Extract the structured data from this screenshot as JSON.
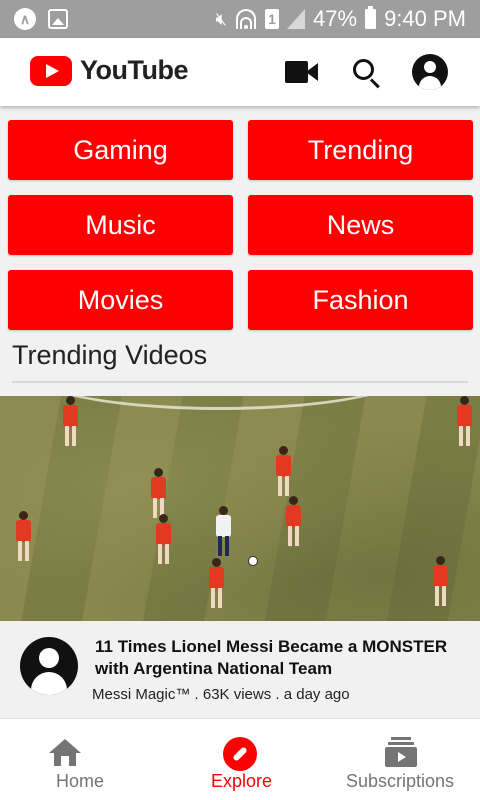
{
  "status_bar": {
    "battery": "47%",
    "time": "9:40 PM",
    "sim_slot": "1"
  },
  "app_bar": {
    "title": "YouTube"
  },
  "categories": [
    {
      "label": "Gaming"
    },
    {
      "label": "Trending"
    },
    {
      "label": "Music"
    },
    {
      "label": "News"
    },
    {
      "label": "Movies"
    },
    {
      "label": "Fashion"
    }
  ],
  "section": {
    "title": "Trending Videos"
  },
  "video": {
    "title": "11 Times Lionel Messi Became a MONSTER with Argentina National Team",
    "meta": "Messi Magic™ . 63K views . a day ago"
  },
  "bottom_nav": [
    {
      "label": "Home",
      "icon": "home-icon"
    },
    {
      "label": "Explore",
      "icon": "explore-icon"
    },
    {
      "label": "Subscriptions",
      "icon": "subscriptions-icon"
    }
  ],
  "colors": {
    "accent": "#ff0000",
    "status_bar": "#9e9e9e"
  }
}
